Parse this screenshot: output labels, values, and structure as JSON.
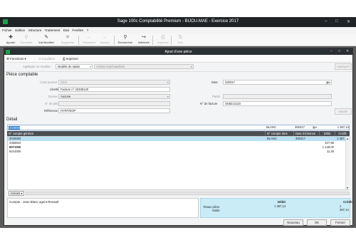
{
  "window": {
    "title": "Sage 100c Comptabilité Premium - BIJOU.MAE - Exercice 2017"
  },
  "menu": [
    "Fichier",
    "Edition",
    "Structure",
    "Traitement",
    "Etat",
    "Fenêtre",
    "?"
  ],
  "toolbar": [
    {
      "label": "Ajouter",
      "icon": "plus-icon",
      "enabled": true
    },
    {
      "label": "Consulter",
      "icon": "search-icon",
      "enabled": false
    },
    {
      "label": "Voir/Modifier",
      "icon": "edit-icon",
      "enabled": true
    },
    {
      "label": "Supprimer",
      "icon": "delete-icon",
      "enabled": false
    },
    {
      "label": "Précédent",
      "icon": "arrow-left-icon",
      "enabled": false
    },
    {
      "label": "Suivant",
      "icon": "arrow-right-icon",
      "enabled": false
    },
    {
      "label": "Rechercher",
      "icon": "magnifier-icon",
      "enabled": true
    },
    {
      "label": "Atteindre",
      "icon": "goto-icon",
      "enabled": true
    },
    {
      "label": "Imprimer",
      "icon": "print-icon",
      "enabled": false
    },
    {
      "label": "Trier",
      "icon": "sort-icon",
      "enabled": false
    }
  ],
  "dialog": {
    "title": "Ajout d'une pièce",
    "bar": {
      "functions": "Fonctions",
      "balance": "Equilibrer",
      "print": "Imprimer"
    },
    "model_label": "Appliquer un modèle :",
    "model_type": "Modèle de saisie",
    "model_value": "Achats marchandises",
    "apply": "Appliquer",
    "piece_section": "Pièce comptable",
    "journal_label": "Code journal",
    "journal": "ACH",
    "date_label": "Date",
    "date": "240317",
    "libelle_label": "Libellé",
    "libelle": "Facture n° 22338120",
    "devise_label": "Devise",
    "devise": "Aucune",
    "parite_label": "Parité",
    "num_piece_label": "N° de pièce",
    "num_facture_label": "N° de facture",
    "num_facture": "G58212123",
    "reference_label": "Référence",
    "reference": "HYRT/KOP",
    "valider": "Valider",
    "detail_section": "Détail",
    "entry": {
      "account": "4040000",
      "tiers": "BLANC",
      "echeance": "300417",
      "debit": "",
      "credit": "1 367,14"
    },
    "columns": [
      "N° compte général",
      "N° compte tiers",
      "Date échéance",
      "Débit",
      "Crédit"
    ],
    "rows": [
      {
        "account": "4040000",
        "tiers": "BLANC",
        "echeance": "300417",
        "debit": "",
        "credit": "1 367,14",
        "selected": true
      },
      {
        "account": "4456610",
        "tiers": "",
        "echeance": "",
        "debit": "227,86",
        "credit": "",
        "selected": false
      },
      {
        "account": "6071000",
        "tiers": "",
        "echeance": "",
        "debit": "1 128,00",
        "credit": "",
        "selected": false,
        "bold": true
      },
      {
        "account": "6241000",
        "tiers": "",
        "echeance": "",
        "debit": "11,28",
        "credit": "",
        "selected": false
      }
    ],
    "actions": "Actions",
    "account_info": "Compte : Jean Blanc agent Renault",
    "totals": {
      "total_label": "Totaux pièce",
      "solde_label": "Solde",
      "debit_head": "Débit",
      "credit_head": "Crédit",
      "debit": "1 367,14",
      "credit": "1 367,14"
    },
    "footer": {
      "nouveau": "Nouveau",
      "ok": "OK",
      "fermer": "Fermer"
    }
  }
}
